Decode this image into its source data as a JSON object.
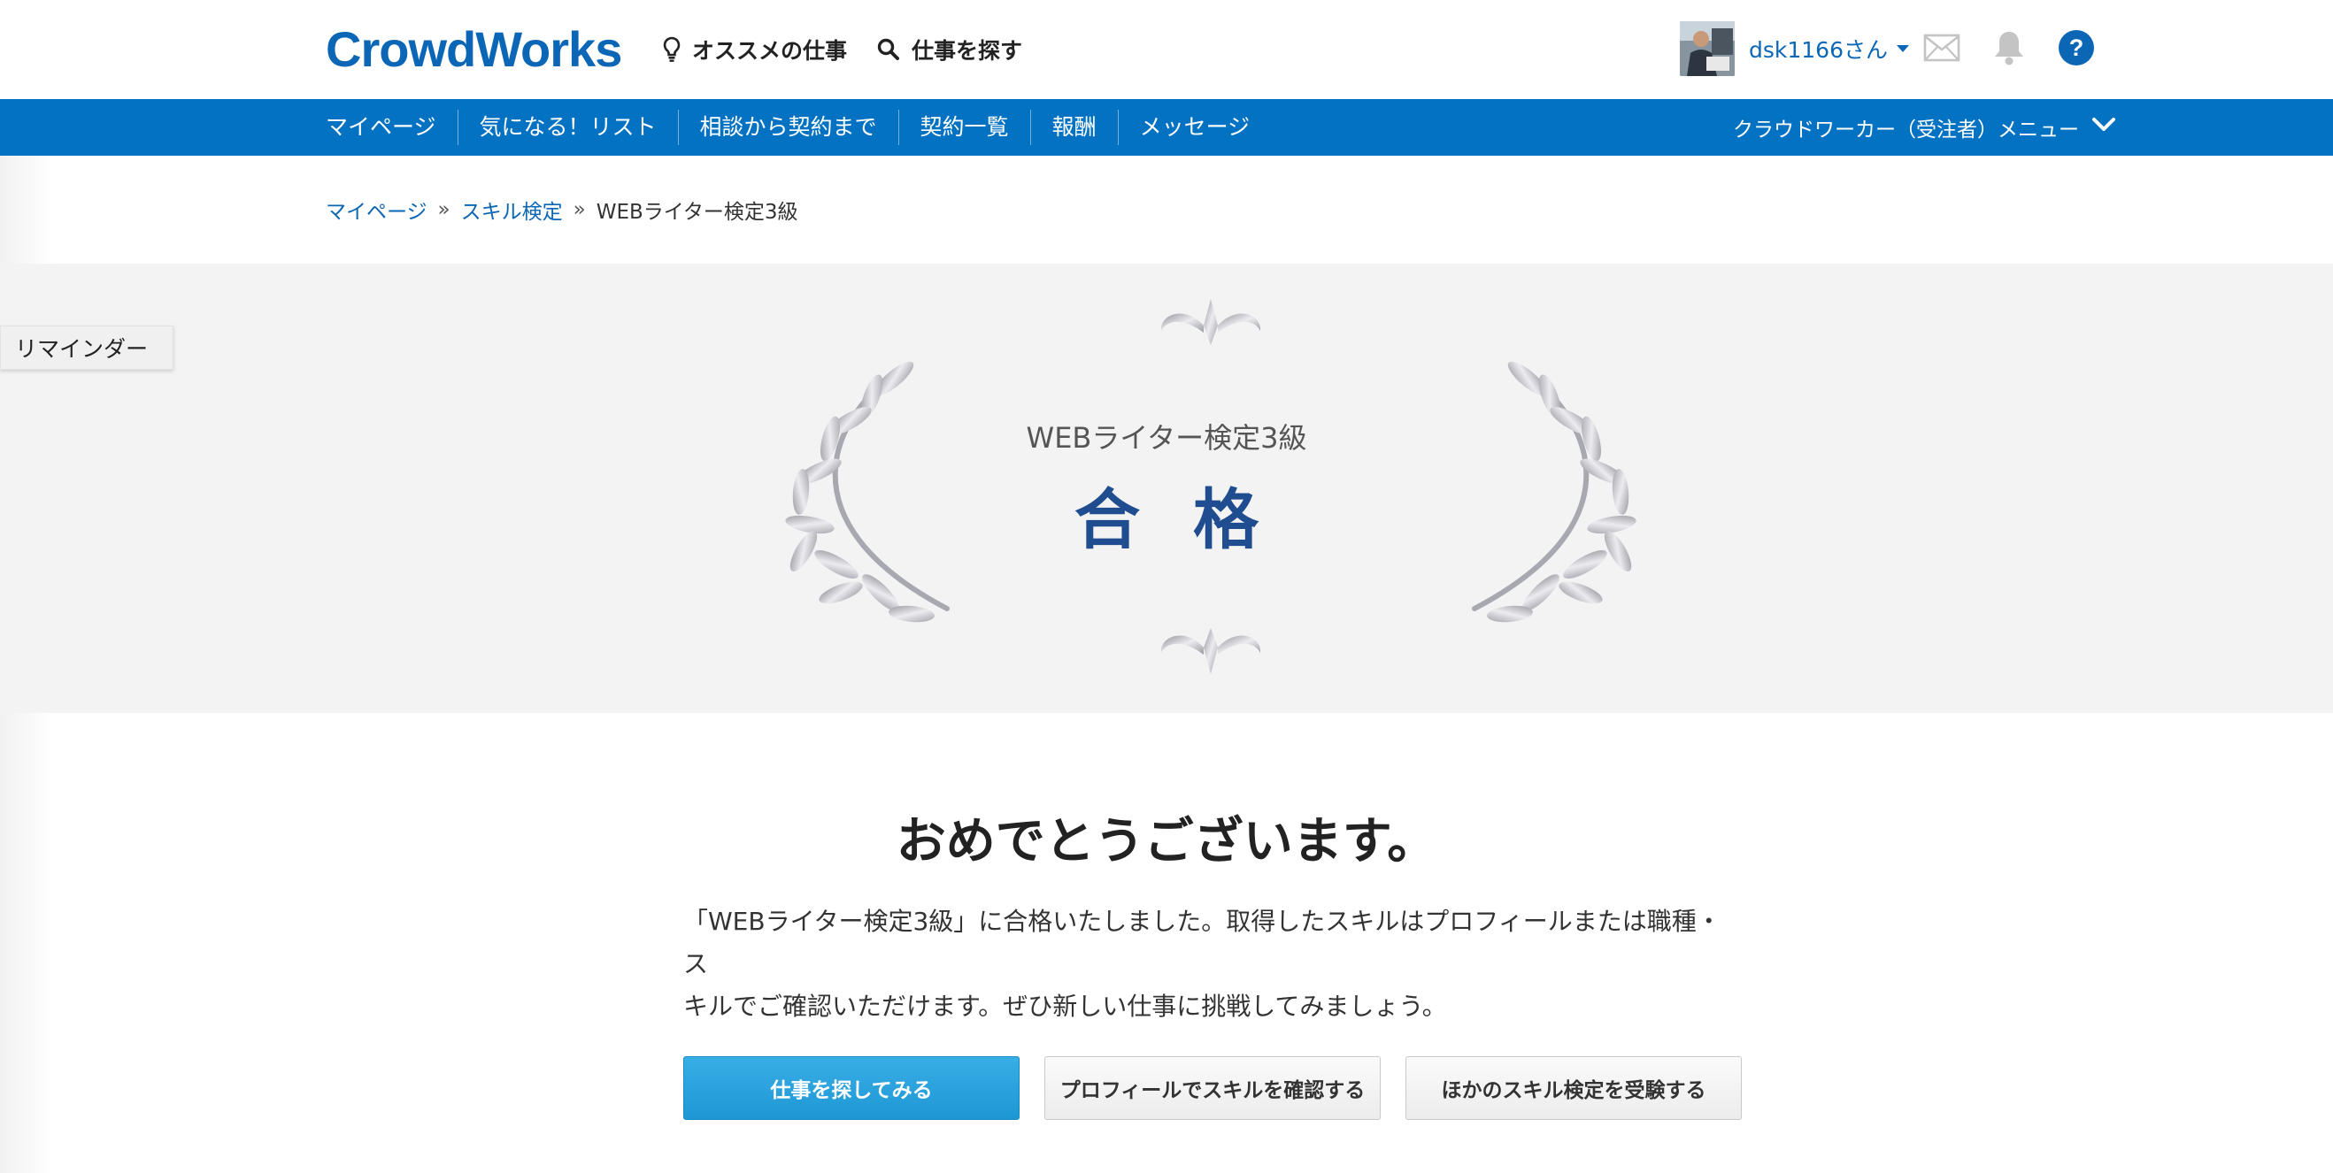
{
  "header": {
    "logo": "CrowdWorks",
    "recommend_label": "オススメの仕事",
    "search_label": "仕事を探す",
    "username": "dsk1166さん",
    "accent_color": "#0b66b5"
  },
  "nav": {
    "items": [
      {
        "label": "マイページ"
      },
      {
        "label": "気になる！リスト"
      },
      {
        "label": "相談から契約まで"
      },
      {
        "label": "契約一覧"
      },
      {
        "label": "報酬"
      },
      {
        "label": "メッセージ"
      }
    ],
    "menu_label": "クラウドワーカー（受注者）メニュー",
    "background_color": "#0372c2"
  },
  "breadcrumb": {
    "items": [
      "マイページ",
      "スキル検定"
    ],
    "current": "WEBライター検定3級",
    "separator": "»"
  },
  "reminder": {
    "label": "リマインダー"
  },
  "result": {
    "test_name": "WEBライター検定3級",
    "status": "合格"
  },
  "content": {
    "congrats": "おめでとうございます。",
    "message_line1": "「WEBライター検定3級」に合格いたしました。取得したスキルはプロフィールまたは職種・ス",
    "message_line2": "キルでご確認いただけます。ぜひ新しい仕事に挑戦してみましょう。"
  },
  "buttons": {
    "find_jobs": "仕事を探してみる",
    "check_profile": "プロフィールでスキルを確認する",
    "other_tests": "ほかのスキル検定を受験する"
  },
  "icons": {
    "recommend": "lightbulb-icon",
    "search": "search-icon",
    "mail": "mail-icon",
    "bell": "bell-icon",
    "help": "help-icon",
    "chevron": "chevron-down-icon"
  }
}
